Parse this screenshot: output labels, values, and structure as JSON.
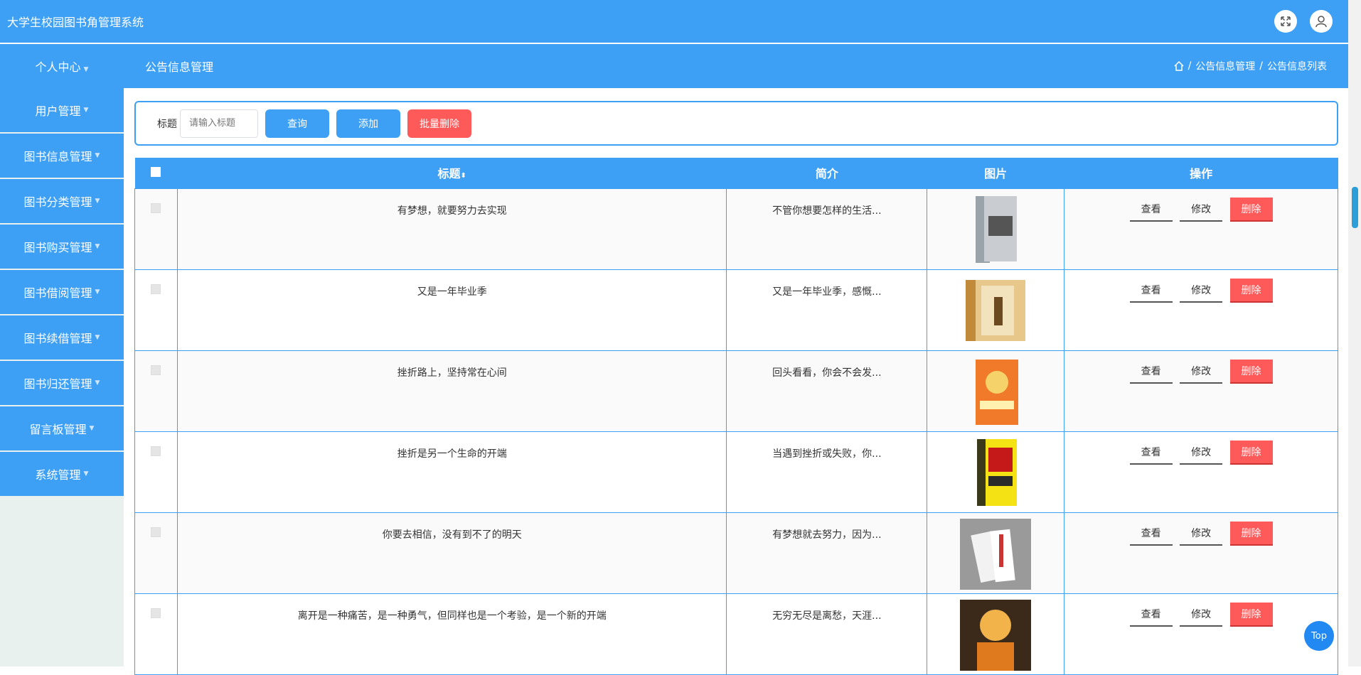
{
  "header": {
    "app_title": "大学生校园图书角管理系统",
    "icons": [
      "fullscreen-icon",
      "user-icon"
    ]
  },
  "subbar": {
    "profile_label": "个人中心",
    "page_title": "公告信息管理",
    "breadcrumb": [
      "公告信息管理",
      "公告信息列表"
    ]
  },
  "sidebar": {
    "items": [
      {
        "label": "用户管理"
      },
      {
        "label": "图书信息管理"
      },
      {
        "label": "图书分类管理"
      },
      {
        "label": "图书购买管理"
      },
      {
        "label": "图书借阅管理"
      },
      {
        "label": "图书续借管理"
      },
      {
        "label": "图书归还管理"
      },
      {
        "label": "留言板管理"
      },
      {
        "label": "系统管理"
      }
    ]
  },
  "search": {
    "label": "标题",
    "placeholder": "请输入标题",
    "query_label": "查询",
    "add_label": "添加",
    "batch_delete_label": "批量删除"
  },
  "table": {
    "headers": {
      "title": "标题",
      "summary": "简介",
      "image": "图片",
      "actions": "操作"
    },
    "actions": {
      "view": "查看",
      "edit": "修改",
      "delete": "删除"
    },
    "rows": [
      {
        "title": "有梦想，就要努力去实现",
        "summary": "不管你想要怎样的生活..."
      },
      {
        "title": "又是一年毕业季",
        "summary": "又是一年毕业季，感慨..."
      },
      {
        "title": "挫折路上，坚持常在心间",
        "summary": "回头看看，你会不会发..."
      },
      {
        "title": "挫折是另一个生命的开端",
        "summary": "当遇到挫折或失败，你..."
      },
      {
        "title": "你要去相信，没有到不了的明天",
        "summary": "有梦想就去努力，因为..."
      },
      {
        "title": "离开是一种痛苦，是一种勇气，但同样也是一个考验，是一个新的开端",
        "summary": "无穷无尽是离愁，天涯..."
      }
    ]
  },
  "top_button": "Top",
  "colors": {
    "primary": "#3ea0f5",
    "danger": "#fe5a5a"
  }
}
